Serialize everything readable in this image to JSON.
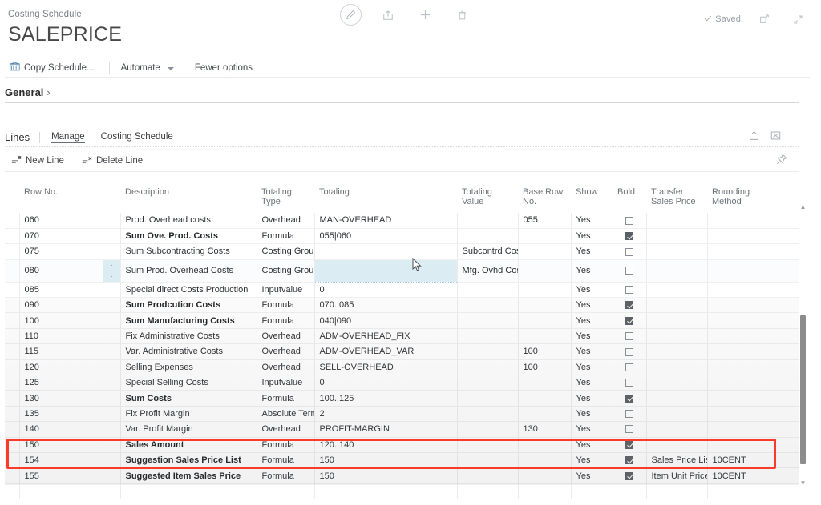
{
  "window": {
    "breadcrumb": "Costing Schedule",
    "title": "SALEPRICE",
    "save_status": "Saved",
    "icons": {
      "edit": "pencil-icon",
      "share": "share-icon",
      "new": "plus-icon",
      "delete": "trash-icon",
      "check": "check-icon",
      "open_new_window": "open-in-new-window-icon",
      "minimize": "collapse-icon"
    }
  },
  "ribbon": {
    "copy_schedule": "Copy Schedule...",
    "automate": "Automate",
    "fewer_options": "Fewer options"
  },
  "general": {
    "label": "General",
    "chevron": "›"
  },
  "lines": {
    "title": "Lines",
    "tabs": [
      {
        "label": "Manage",
        "active": true
      },
      {
        "label": "Costing Schedule",
        "active": false
      }
    ],
    "toolbar": [
      {
        "label": "New Line",
        "icon": "new-line-icon"
      },
      {
        "label": "Delete Line",
        "icon": "delete-line-icon"
      }
    ],
    "header_icons": [
      "share-icon",
      "open-in-excel-icon"
    ],
    "toolbar_right_icon": "pin-icon"
  },
  "grid": {
    "columns": [
      "Row No.",
      "",
      "Description",
      "Totaling Type",
      "Totaling",
      "Totaling Value",
      "Base Row No.",
      "Show",
      "Bold",
      "Transfer Sales Price",
      "Rounding Method"
    ],
    "rows": [
      {
        "row_no": "060",
        "description": "Prod. Overhead costs",
        "totaling_type": "Overhead",
        "totaling": "MAN-OVERHEAD",
        "totaling_value": "",
        "base_row_no": "055",
        "show": "Yes",
        "bold": false,
        "transfer_sales_price": "",
        "rounding_method": "",
        "bold_text": false
      },
      {
        "row_no": "070",
        "description": "Sum Ove. Prod. Costs",
        "totaling_type": "Formula",
        "totaling": "055|060",
        "totaling_value": "",
        "base_row_no": "",
        "show": "Yes",
        "bold": true,
        "transfer_sales_price": "",
        "rounding_method": "",
        "bold_text": true
      },
      {
        "row_no": "075",
        "description": "Sum Subcontracting Costs",
        "totaling_type": "Costing Group",
        "totaling": "",
        "totaling_value": "Subcontrd Cost",
        "base_row_no": "",
        "show": "Yes",
        "bold": false,
        "transfer_sales_price": "",
        "rounding_method": "",
        "bold_text": false
      },
      {
        "row_no": "080",
        "description": "Sum Prod. Overhead Costs",
        "totaling_type": "Costing Group",
        "totaling": "",
        "totaling_value": "Mfg. Ovhd Cost",
        "base_row_no": "",
        "show": "Yes",
        "bold": false,
        "transfer_sales_price": "",
        "rounding_method": "",
        "bold_text": false
      },
      {
        "row_no": "085",
        "description": "Special direct Costs Production",
        "totaling_type": "Inputvalue",
        "totaling": "0",
        "totaling_value": "",
        "base_row_no": "",
        "show": "Yes",
        "bold": false,
        "transfer_sales_price": "",
        "rounding_method": "",
        "bold_text": false
      },
      {
        "row_no": "090",
        "description": "Sum Prodcution Costs",
        "totaling_type": "Formula",
        "totaling": "070..085",
        "totaling_value": "",
        "base_row_no": "",
        "show": "Yes",
        "bold": true,
        "transfer_sales_price": "",
        "rounding_method": "",
        "bold_text": true
      },
      {
        "row_no": "100",
        "description": "Sum Manufacturing Costs",
        "totaling_type": "Formula",
        "totaling": "040|090",
        "totaling_value": "",
        "base_row_no": "",
        "show": "Yes",
        "bold": true,
        "transfer_sales_price": "",
        "rounding_method": "",
        "bold_text": true
      },
      {
        "row_no": "110",
        "description": "Fix Administrative Costs",
        "totaling_type": "Overhead",
        "totaling": "ADM-OVERHEAD_FIX",
        "totaling_value": "",
        "base_row_no": "",
        "show": "Yes",
        "bold": false,
        "transfer_sales_price": "",
        "rounding_method": "",
        "bold_text": false
      },
      {
        "row_no": "115",
        "description": "Var. Administrative Costs",
        "totaling_type": "Overhead",
        "totaling": "ADM-OVERHEAD_VAR",
        "totaling_value": "",
        "base_row_no": "100",
        "show": "Yes",
        "bold": false,
        "transfer_sales_price": "",
        "rounding_method": "",
        "bold_text": false
      },
      {
        "row_no": "120",
        "description": "Selling Expenses",
        "totaling_type": "Overhead",
        "totaling": "SELL-OVERHEAD",
        "totaling_value": "",
        "base_row_no": "100",
        "show": "Yes",
        "bold": false,
        "transfer_sales_price": "",
        "rounding_method": "",
        "bold_text": false
      },
      {
        "row_no": "125",
        "description": "Special Selling Costs",
        "totaling_type": "Inputvalue",
        "totaling": "0",
        "totaling_value": "",
        "base_row_no": "",
        "show": "Yes",
        "bold": false,
        "transfer_sales_price": "",
        "rounding_method": "",
        "bold_text": false
      },
      {
        "row_no": "130",
        "description": "Sum Costs",
        "totaling_type": "Formula",
        "totaling": "100..125",
        "totaling_value": "",
        "base_row_no": "",
        "show": "Yes",
        "bold": true,
        "transfer_sales_price": "",
        "rounding_method": "",
        "bold_text": true
      },
      {
        "row_no": "135",
        "description": "Fix Profit Margin",
        "totaling_type": "Absolute Term",
        "totaling": "2",
        "totaling_value": "",
        "base_row_no": "",
        "show": "Yes",
        "bold": false,
        "transfer_sales_price": "",
        "rounding_method": "",
        "bold_text": false
      },
      {
        "row_no": "140",
        "description": "Var. Profit Margin",
        "totaling_type": "Overhead",
        "totaling": "PROFIT-MARGIN",
        "totaling_value": "",
        "base_row_no": "130",
        "show": "Yes",
        "bold": false,
        "transfer_sales_price": "",
        "rounding_method": "",
        "bold_text": false
      },
      {
        "row_no": "150",
        "description": "Sales Amount",
        "totaling_type": "Formula",
        "totaling": "120..140",
        "totaling_value": "",
        "base_row_no": "",
        "show": "Yes",
        "bold": true,
        "transfer_sales_price": "",
        "rounding_method": "",
        "bold_text": true
      },
      {
        "row_no": "154",
        "description": "Suggestion Sales Price List",
        "totaling_type": "Formula",
        "totaling": "150",
        "totaling_value": "",
        "base_row_no": "",
        "show": "Yes",
        "bold": true,
        "transfer_sales_price": "Sales Price List",
        "rounding_method": "10CENT",
        "bold_text": true
      },
      {
        "row_no": "155",
        "description": "Suggested Item Sales Price",
        "totaling_type": "Formula",
        "totaling": "150",
        "totaling_value": "",
        "base_row_no": "",
        "show": "Yes",
        "bold": true,
        "transfer_sales_price": "Item Unit Price",
        "rounding_method": "10CENT",
        "bold_text": true
      }
    ],
    "selected_row_no": "080",
    "active_cell_column": "Totaling"
  },
  "annotation": {
    "highlight_color": "#f93b28",
    "highlighted_row_numbers": [
      "154",
      "155"
    ]
  }
}
